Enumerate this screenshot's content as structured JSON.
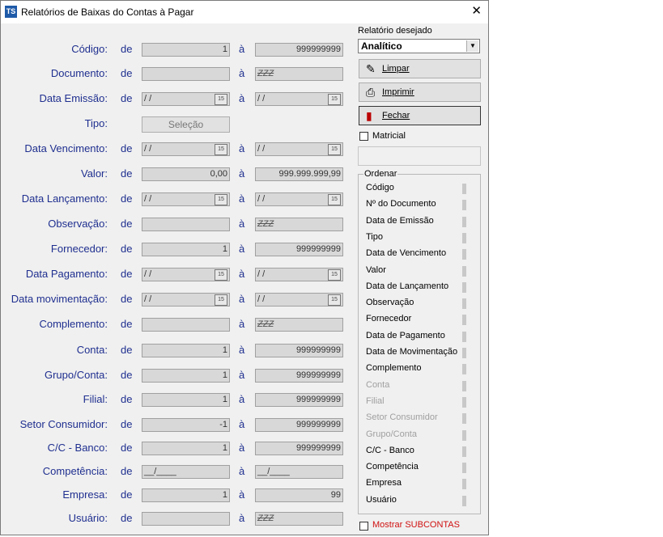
{
  "window": {
    "icon_text": "TS",
    "title": "Relatórios de Baixas do Contas à Pagar",
    "close_glyph": "✕"
  },
  "form": {
    "de_label": "de",
    "a_label": "à",
    "date_icon_text": "15",
    "rows": [
      {
        "label": "Código:",
        "from": "1",
        "to": "999999999",
        "kind": "num"
      },
      {
        "label": "Documento:",
        "from": "",
        "to": "ZZZ",
        "kind": "text"
      },
      {
        "label": "Data Emissão:",
        "from": " /  /",
        "to": " /  /",
        "kind": "date"
      },
      {
        "label": "Tipo:",
        "button": "Seleção",
        "kind": "button"
      },
      {
        "label": "Data Vencimento:",
        "from": " /  /",
        "to": " /  /",
        "kind": "date"
      },
      {
        "label": "Valor:",
        "from": "0,00",
        "to": "999.999.999,99",
        "kind": "num"
      },
      {
        "label": "Data Lançamento:",
        "from": " /  /",
        "to": " /  /",
        "kind": "date"
      },
      {
        "label": "Observação:",
        "from": "",
        "to": "ZZZ",
        "kind": "text"
      },
      {
        "label": "Fornecedor:",
        "from": "1",
        "to": "999999999",
        "kind": "num"
      },
      {
        "label": "Data Pagamento:",
        "from": " /  /",
        "to": " /  /",
        "kind": "date"
      },
      {
        "label": "Data movimentação:",
        "from": " /  /",
        "to": " /  /",
        "kind": "date"
      },
      {
        "label": "Complemento:",
        "from": "",
        "to": "ZZZ",
        "kind": "text"
      },
      {
        "label": "Conta:",
        "from": "1",
        "to": "999999999",
        "kind": "num"
      },
      {
        "label": "Grupo/Conta:",
        "from": "1",
        "to": "999999999",
        "kind": "num"
      },
      {
        "label": "Filial:",
        "from": "1",
        "to": "999999999",
        "kind": "num"
      },
      {
        "label": "Setor Consumidor:",
        "from": "-1",
        "to": "999999999",
        "kind": "num"
      },
      {
        "label": "C/C - Banco:",
        "from": "1",
        "to": "999999999",
        "kind": "num"
      },
      {
        "label": "Competência:",
        "from": "__/____",
        "to": "__/____",
        "kind": "text"
      },
      {
        "label": "Empresa:",
        "from": "1",
        "to": "99",
        "kind": "num"
      },
      {
        "label": "Usuário:",
        "from": "",
        "to": "ZZZ",
        "kind": "text"
      }
    ]
  },
  "right_panel": {
    "report_label": "Relatório desejado",
    "report_value": "Analítico",
    "combo_arrow": "▼",
    "limpar_label": "Limpar",
    "imprimir_label": "Imprimir",
    "fechar_label": "Fechar",
    "matricial_label": "Matricial",
    "ordenar_title": "Ordenar",
    "ordenar_items": [
      {
        "label": "Código",
        "enabled": true
      },
      {
        "label": "Nº do Documento",
        "enabled": true
      },
      {
        "label": "Data de Emissão",
        "enabled": true
      },
      {
        "label": "Tipo",
        "enabled": true
      },
      {
        "label": "Data de Vencimento",
        "enabled": true
      },
      {
        "label": "Valor",
        "enabled": true
      },
      {
        "label": "Data de Lançamento",
        "enabled": true
      },
      {
        "label": "Observação",
        "enabled": true
      },
      {
        "label": "Fornecedor",
        "enabled": true
      },
      {
        "label": "Data de Pagamento",
        "enabled": true
      },
      {
        "label": "Data de Movimentação",
        "enabled": true
      },
      {
        "label": "Complemento",
        "enabled": true
      },
      {
        "label": "Conta",
        "enabled": false
      },
      {
        "label": "Filial",
        "enabled": false
      },
      {
        "label": "Setor Consumidor",
        "enabled": false
      },
      {
        "label": "Grupo/Conta",
        "enabled": false
      },
      {
        "label": "C/C - Banco",
        "enabled": true
      },
      {
        "label": "Competência",
        "enabled": true
      },
      {
        "label": "Empresa",
        "enabled": true
      },
      {
        "label": "Usuário",
        "enabled": true
      }
    ],
    "subcontas_label": "Mostrar SUBCONTAS"
  }
}
